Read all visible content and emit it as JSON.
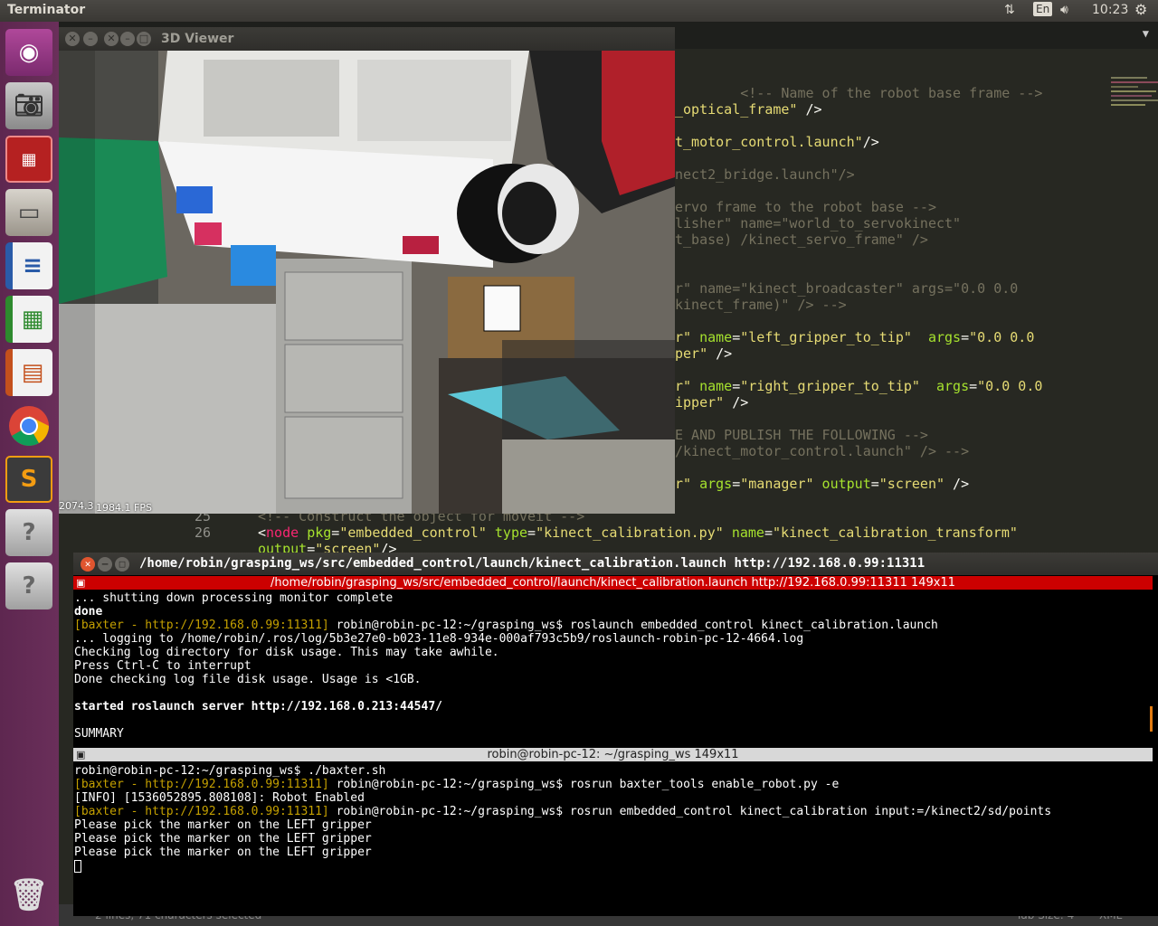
{
  "topbar": {
    "app_name": "Terminator",
    "keyboard": "En",
    "clock": "10:23"
  },
  "launcher": {
    "items": [
      {
        "name": "ubuntu-dash-icon"
      },
      {
        "name": "camera-icon"
      },
      {
        "name": "terminator-icon"
      },
      {
        "name": "file-manager-icon"
      },
      {
        "name": "writer-icon"
      },
      {
        "name": "calc-icon"
      },
      {
        "name": "impress-icon"
      },
      {
        "name": "chrome-icon"
      },
      {
        "name": "sublime-icon"
      },
      {
        "name": "unknown-app-icon"
      },
      {
        "name": "unknown-app-icon"
      },
      {
        "name": "trash-icon"
      }
    ]
  },
  "editor": {
    "lines": [
      {
        "parts": [
          {
            "c": "cm",
            "t": "        <!-- Name of the robot base frame -->"
          }
        ]
      },
      {
        "parts": [
          {
            "c": "st",
            "t": "_optical_frame\""
          },
          {
            "c": "",
            "t": " />"
          }
        ]
      },
      {
        "parts": [
          {
            "c": "",
            "t": ""
          }
        ]
      },
      {
        "parts": [
          {
            "c": "st",
            "t": "t_motor_control.launch\""
          },
          {
            "c": "",
            "t": "/>"
          }
        ]
      },
      {
        "parts": [
          {
            "c": "",
            "t": ""
          }
        ]
      },
      {
        "parts": [
          {
            "c": "cm",
            "t": "nect2_bridge.launch\"/>"
          }
        ]
      },
      {
        "parts": [
          {
            "c": "",
            "t": ""
          }
        ]
      },
      {
        "parts": [
          {
            "c": "cm",
            "t": "ervo frame to the robot base -->"
          }
        ]
      },
      {
        "parts": [
          {
            "c": "cm",
            "t": "lisher\" name=\"world_to_servokinect\""
          }
        ]
      },
      {
        "parts": [
          {
            "c": "cm",
            "t": "t_base) /kinect_servo_frame\" />"
          }
        ]
      },
      {
        "parts": [
          {
            "c": "",
            "t": ""
          }
        ]
      },
      {
        "parts": [
          {
            "c": "",
            "t": ""
          }
        ]
      },
      {
        "parts": [
          {
            "c": "cm",
            "t": "r\" name=\"kinect_broadcaster\" args=\"0.0 0.0"
          }
        ]
      },
      {
        "parts": [
          {
            "c": "cm",
            "t": "kinect_frame)\" /> -->"
          }
        ]
      },
      {
        "parts": [
          {
            "c": "",
            "t": ""
          }
        ]
      },
      {
        "parts": [
          {
            "c": "st",
            "t": "r\""
          },
          {
            "c": "at",
            "t": " name"
          },
          {
            "c": "",
            "t": "="
          },
          {
            "c": "st",
            "t": "\"left_gripper_to_tip\""
          },
          {
            "c": "at",
            "t": "  args"
          },
          {
            "c": "",
            "t": "="
          },
          {
            "c": "st",
            "t": "\"0.0 0.0"
          }
        ]
      },
      {
        "parts": [
          {
            "c": "st",
            "t": "per\""
          },
          {
            "c": "",
            "t": " />"
          }
        ]
      },
      {
        "parts": [
          {
            "c": "",
            "t": ""
          }
        ]
      },
      {
        "parts": [
          {
            "c": "st",
            "t": "r\""
          },
          {
            "c": "at",
            "t": " name"
          },
          {
            "c": "",
            "t": "="
          },
          {
            "c": "st",
            "t": "\"right_gripper_to_tip\""
          },
          {
            "c": "at",
            "t": "  args"
          },
          {
            "c": "",
            "t": "="
          },
          {
            "c": "st",
            "t": "\"0.0 0.0"
          }
        ]
      },
      {
        "parts": [
          {
            "c": "st",
            "t": "ipper\""
          },
          {
            "c": "",
            "t": " />"
          }
        ]
      },
      {
        "parts": [
          {
            "c": "",
            "t": ""
          }
        ]
      },
      {
        "parts": [
          {
            "c": "cm",
            "t": "E AND PUBLISH THE FOLLOWING -->"
          }
        ]
      },
      {
        "parts": [
          {
            "c": "cm",
            "t": "/kinect_motor_control.launch\" /> -->"
          }
        ]
      },
      {
        "parts": [
          {
            "c": "",
            "t": ""
          }
        ]
      },
      {
        "parts": [
          {
            "c": "st",
            "t": "r\""
          },
          {
            "c": "at",
            "t": " args"
          },
          {
            "c": "",
            "t": "="
          },
          {
            "c": "st",
            "t": "\"manager\""
          },
          {
            "c": "at",
            "t": " output"
          },
          {
            "c": "",
            "t": "="
          },
          {
            "c": "st",
            "t": "\"screen\""
          },
          {
            "c": "",
            "t": " />"
          }
        ]
      }
    ],
    "line25_num": "25",
    "line25_text": "<!-- Construct the object for moveit -->",
    "line26_num": "26",
    "line26_tag": "node",
    "line26_a1": "pkg",
    "line26_v1": "\"embedded_control\"",
    "line26_a2": "type",
    "line26_v2": "\"kinect_calibration.py\"",
    "line26_a3": "name",
    "line26_v3": "\"kinect_calibration_transform\"",
    "line27_a": "output",
    "line27_v": "\"screen\"",
    "line27_end": "/>",
    "status_left": "2 lines, 71 characters selected",
    "status_tab": "Tab Size: 4",
    "status_lang": "XML"
  },
  "viewer": {
    "title": "3D Viewer",
    "fps1": "2074.3",
    "fps2": "1984.1 FPS"
  },
  "terminal": {
    "title": "/home/robin/grasping_ws/src/embedded_control/launch/kinect_calibration.launch http://192.168.0.99:11311",
    "pane1_title": "/home/robin/grasping_ws/src/embedded_control/launch/kinect_calibration.launch http://192.168.0.99:11311 149x11",
    "pane1_lines": [
      {
        "parts": [
          {
            "c": "",
            "t": "... shutting down processing monitor complete"
          }
        ]
      },
      {
        "parts": [
          {
            "c": "b",
            "t": "done"
          }
        ]
      },
      {
        "parts": [
          {
            "c": "y",
            "t": "[baxter - http://192.168.0.99:11311]"
          },
          {
            "c": "",
            "t": " robin@robin-pc-12:~/grasping_ws$ roslaunch embedded_control kinect_calibration.launch"
          }
        ]
      },
      {
        "parts": [
          {
            "c": "",
            "t": "... logging to /home/robin/.ros/log/5b3e27e0-b023-11e8-934e-000af793c5b9/roslaunch-robin-pc-12-4664.log"
          }
        ]
      },
      {
        "parts": [
          {
            "c": "",
            "t": "Checking log directory for disk usage. This may take awhile."
          }
        ]
      },
      {
        "parts": [
          {
            "c": "",
            "t": "Press Ctrl-C to interrupt"
          }
        ]
      },
      {
        "parts": [
          {
            "c": "",
            "t": "Done checking log file disk usage. Usage is <1GB."
          }
        ]
      },
      {
        "parts": [
          {
            "c": "",
            "t": ""
          }
        ]
      },
      {
        "parts": [
          {
            "c": "b",
            "t": "started roslaunch server http://192.168.0.213:44547/"
          }
        ]
      },
      {
        "parts": [
          {
            "c": "",
            "t": ""
          }
        ]
      },
      {
        "parts": [
          {
            "c": "",
            "t": "SUMMARY"
          }
        ]
      }
    ],
    "pane2_title": "robin@robin-pc-12: ~/grasping_ws 149x11",
    "pane2_lines": [
      {
        "parts": [
          {
            "c": "",
            "t": "robin@robin-pc-12:~/grasping_ws$ ./baxter.sh"
          }
        ]
      },
      {
        "parts": [
          {
            "c": "y",
            "t": "[baxter - http://192.168.0.99:11311]"
          },
          {
            "c": "",
            "t": " robin@robin-pc-12:~/grasping_ws$ rosrun baxter_tools enable_robot.py -e"
          }
        ]
      },
      {
        "parts": [
          {
            "c": "",
            "t": "[INFO] [1536052895.808108]: Robot Enabled"
          }
        ]
      },
      {
        "parts": [
          {
            "c": "y",
            "t": "[baxter - http://192.168.0.99:11311]"
          },
          {
            "c": "",
            "t": " robin@robin-pc-12:~/grasping_ws$ rosrun embedded_control kinect_calibration input:=/kinect2/sd/points"
          }
        ]
      },
      {
        "parts": [
          {
            "c": "",
            "t": "Please pick the marker on the LEFT gripper"
          }
        ]
      },
      {
        "parts": [
          {
            "c": "",
            "t": "Please pick the marker on the LEFT gripper"
          }
        ]
      },
      {
        "parts": [
          {
            "c": "",
            "t": "Please pick the marker on the LEFT gripper"
          }
        ]
      }
    ]
  }
}
